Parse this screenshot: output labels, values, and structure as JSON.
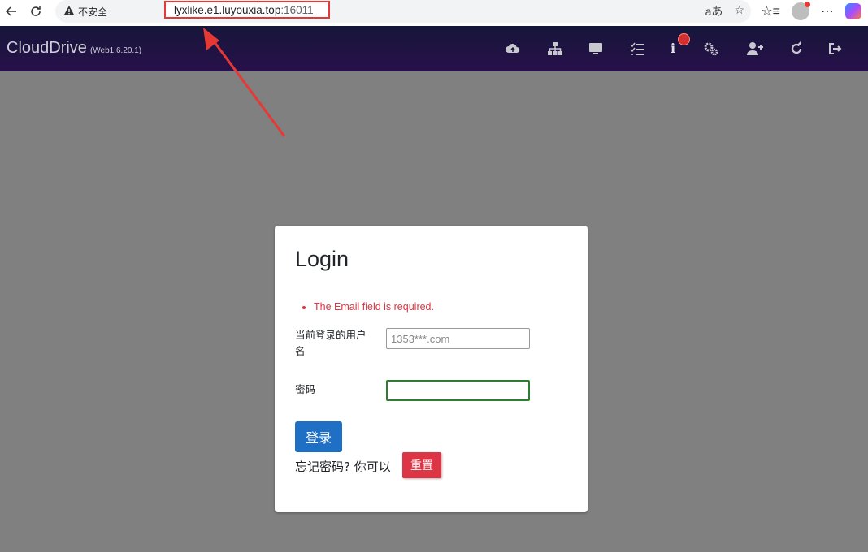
{
  "browser": {
    "security_label": "不安全",
    "url_host": "lyxlike.e1.luyouxia.top",
    "url_port": ":16011",
    "read_aloud_glyph": "aあ"
  },
  "app": {
    "brand": "CloudDrive",
    "version": "(Web1.6.20.1)",
    "header_icons": [
      "cloud-upload-icon",
      "sitemap-icon",
      "desktop-icon",
      "tasks-icon",
      "info-icon",
      "cogs-icon",
      "user-plus-icon",
      "refresh-icon",
      "sign-out-icon"
    ]
  },
  "login": {
    "title": "Login",
    "errors": [
      "The Email field is required."
    ],
    "username_label": "当前登录的用户名",
    "username_placeholder": "1353***.com",
    "password_label": "密码",
    "login_button": "登录",
    "forgot_text": "忘记密码? 你可以",
    "reset_button": "重置"
  },
  "colors": {
    "annotation_red": "#e53935",
    "header_bg": "#1d1440",
    "primary": "#1f6fc5",
    "danger": "#dc3545",
    "page_bg": "#808080"
  }
}
